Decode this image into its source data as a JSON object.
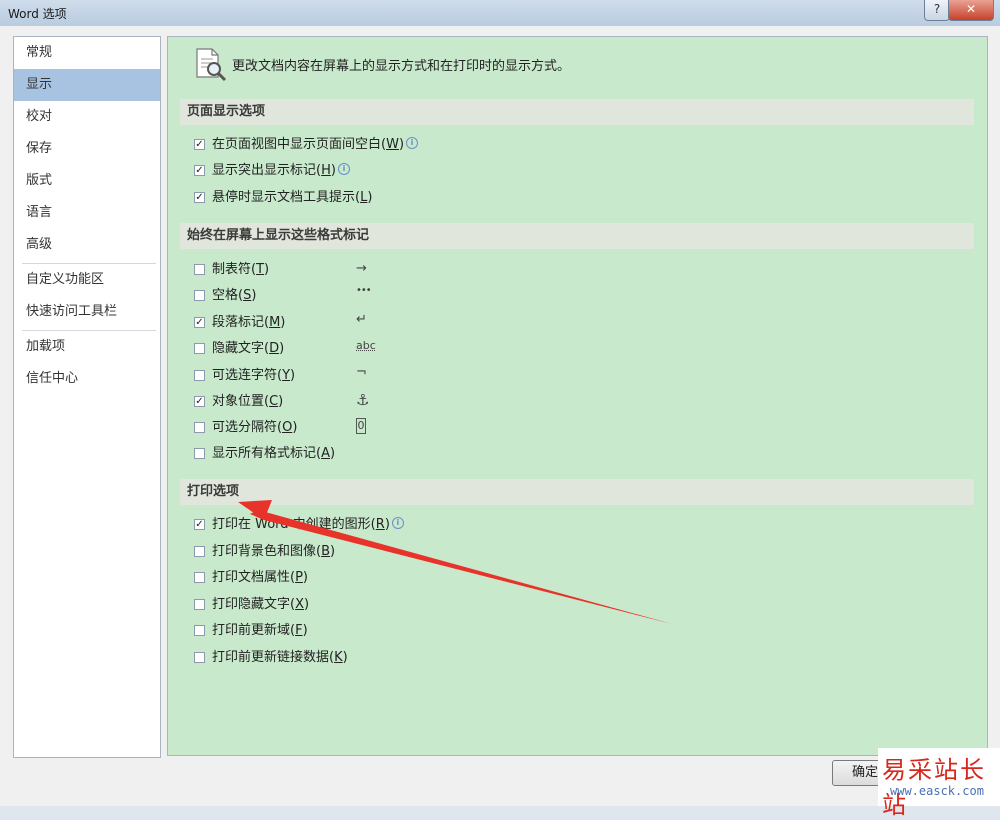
{
  "window": {
    "title": "Word 选项",
    "help": "?",
    "close": "✕"
  },
  "sidebar": {
    "items": [
      {
        "label": "常规"
      },
      {
        "label": "显示"
      },
      {
        "label": "校对"
      },
      {
        "label": "保存"
      },
      {
        "label": "版式"
      },
      {
        "label": "语言"
      },
      {
        "label": "高级"
      },
      {
        "label": "自定义功能区"
      },
      {
        "label": "快速访问工具栏"
      },
      {
        "label": "加载项"
      },
      {
        "label": "信任中心"
      }
    ],
    "selected": "显示"
  },
  "content": {
    "header": "更改文档内容在屏幕上的显示方式和在打印时的显示方式。",
    "sections": {
      "page_display": {
        "title": "页面显示选项",
        "options": [
          {
            "text": "在页面视图中显示页面间空白(",
            "key": "W",
            "close": ")",
            "checked": true,
            "info": true
          },
          {
            "text": "显示突出显示标记(",
            "key": "H",
            "close": ")",
            "checked": true,
            "info": true
          },
          {
            "text": "悬停时显示文档工具提示(",
            "key": "L",
            "close": ")",
            "checked": true,
            "info": false
          }
        ]
      },
      "format_marks": {
        "title": "始终在屏幕上显示这些格式标记",
        "options": [
          {
            "text": "制表符(",
            "key": "T",
            "close": ")",
            "checked": false,
            "symbol": "→"
          },
          {
            "text": "空格(",
            "key": "S",
            "close": ")",
            "checked": false,
            "symbol": "•••"
          },
          {
            "text": "段落标记(",
            "key": "M",
            "close": ")",
            "checked": true,
            "symbol": "↵"
          },
          {
            "text": "隐藏文字(",
            "key": "D",
            "close": ")",
            "checked": false,
            "symbol": "abc"
          },
          {
            "text": "可选连字符(",
            "key": "Y",
            "close": ")",
            "checked": false,
            "symbol": "¬"
          },
          {
            "text": "对象位置(",
            "key": "C",
            "close": ")",
            "checked": true,
            "symbol": "⚓"
          },
          {
            "text": "可选分隔符(",
            "key": "O",
            "close": ")",
            "checked": false,
            "symbol": "0"
          },
          {
            "text": "显示所有格式标记(",
            "key": "A",
            "close": ")",
            "checked": false
          }
        ]
      },
      "print": {
        "title": "打印选项",
        "options": [
          {
            "text": "打印在 Word 中创建的图形(",
            "key": "R",
            "close": ")",
            "checked": true,
            "info": true
          },
          {
            "text": "打印背景色和图像(",
            "key": "B",
            "close": ")",
            "checked": false
          },
          {
            "text": "打印文档属性(",
            "key": "P",
            "close": ")",
            "checked": false
          },
          {
            "text": "打印隐藏文字(",
            "key": "X",
            "close": ")",
            "checked": false
          },
          {
            "text": "打印前更新域(",
            "key": "F",
            "close": ")",
            "checked": false
          },
          {
            "text": "打印前更新链接数据(",
            "key": "K",
            "close": ")",
            "checked": false
          }
        ]
      }
    }
  },
  "footer": {
    "ok_label": "确定"
  },
  "watermark": {
    "cn": "易采站长站",
    "url": "www.easck.com"
  },
  "colors": {
    "content_bg": "#c8e9cc",
    "selected_nav": "#a8c3e1",
    "arrow": "#e8332a"
  }
}
